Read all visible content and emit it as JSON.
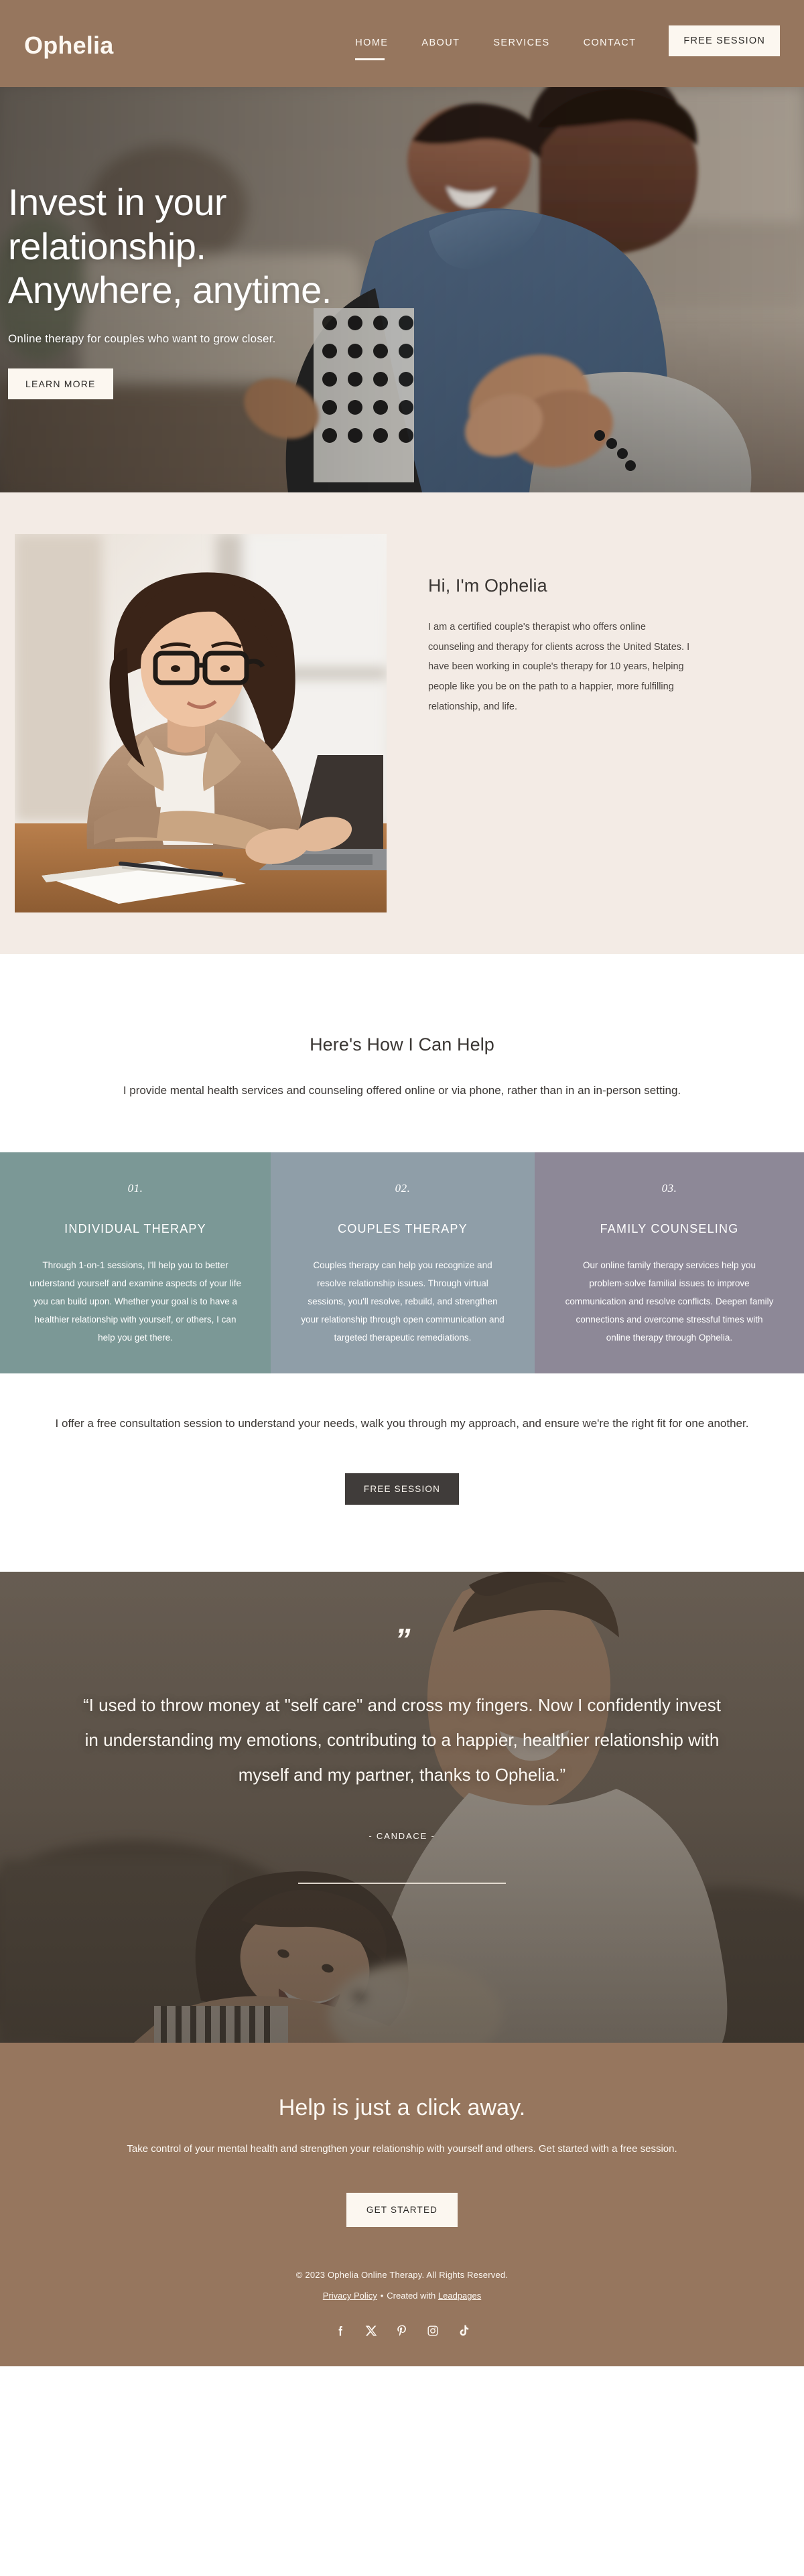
{
  "header": {
    "brand": "Ophelia",
    "nav": [
      {
        "label": "HOME",
        "active": true
      },
      {
        "label": "ABOUT",
        "active": false
      },
      {
        "label": "SERVICES",
        "active": false
      },
      {
        "label": "CONTACT",
        "active": false
      }
    ],
    "cta_label": "FREE SESSION",
    "bg_color": "#96765e"
  },
  "hero": {
    "title_line1": "Invest in your",
    "title_line2": "relationship.",
    "title_line3": "Anywhere, anytime.",
    "subtitle": "Online therapy for couples who want to grow closer.",
    "button_label": "LEARN MORE"
  },
  "about": {
    "heading": "Hi, I'm Ophelia",
    "paragraph": "I am a certified couple's therapist who offers online counseling and therapy for clients across the United States. I have been working in couple's therapy for 10 years, helping people like you be on the path to a happier, more fulfilling relationship, and life.",
    "bg_color": "#f3ebe5"
  },
  "help": {
    "heading": "Here's How I Can Help",
    "intro": "I provide mental health services and counseling offered online or via phone, rather than in an in-person setting.",
    "cards": [
      {
        "number": "01.",
        "title": "INDIVIDUAL THERAPY",
        "body": "Through 1-on-1 sessions, I'll help you to better understand yourself and examine aspects of your life you can build upon. Whether your goal is to have a healthier relationship with yourself, or others, I can help you get there.",
        "color": "#7b9896"
      },
      {
        "number": "02.",
        "title": "COUPLES THERAPY",
        "body": "Couples therapy can help you recognize and resolve relationship issues. Through virtual sessions, you'll resolve, rebuild, and strengthen your relationship through open communication and targeted therapeutic remediations.",
        "color": "#8f9ea8"
      },
      {
        "number": "03.",
        "title": "FAMILY COUNSELING",
        "body": "Our online family therapy services help you problem-solve familial issues to improve communication and resolve conflicts. Deepen family connections and overcome stressful times with online therapy through Ophelia.",
        "color": "#8d8897"
      }
    ]
  },
  "consult": {
    "paragraph": "I offer a free consultation session to understand your needs, walk you through my approach, and ensure we're the right fit for one another.",
    "button_label": "FREE SESSION"
  },
  "testimonial": {
    "quote_mark": "”",
    "quote": "“I used to throw money at \"self care\" and cross my fingers. Now I confidently invest in understanding my emotions, contributing to a happier, healthier relationship with myself and my partner, thanks to Ophelia.”",
    "author": "- CANDACE -"
  },
  "cta": {
    "heading": "Help is just a click away.",
    "paragraph": "Take control of your mental health and strengthen your relationship with yourself and others. Get started with a free session.",
    "button_label": "GET STARTED"
  },
  "footer": {
    "copyright": "© 2023 Ophelia Online Therapy. All Rights Reserved.",
    "privacy_label": "Privacy Policy",
    "separator": "•",
    "created_with_prefix": "Created with",
    "created_with_link": "Leadpages",
    "socials": [
      {
        "name": "facebook"
      },
      {
        "name": "x-twitter"
      },
      {
        "name": "pinterest"
      },
      {
        "name": "instagram"
      },
      {
        "name": "tiktok"
      }
    ]
  }
}
